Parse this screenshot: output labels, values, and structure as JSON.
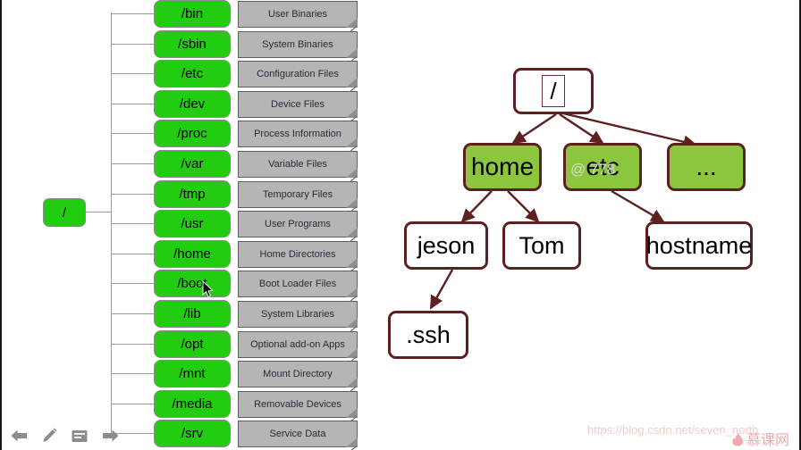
{
  "colors": {
    "dir_chip_green": "#22cc11",
    "note_gray": "#b5b5b5",
    "tree_node_green": "#8cc63e",
    "tree_border": "#5e1f1f",
    "connector_gray": "#9a9a9a",
    "watermark_pink": "#f0cccc",
    "toolbar_gray": "#8c8c8c"
  },
  "left_diagram": {
    "root_label": "/",
    "rows": [
      {
        "dir": "/bin",
        "desc": "User Binaries"
      },
      {
        "dir": "/sbin",
        "desc": "System Binaries"
      },
      {
        "dir": "/etc",
        "desc": "Configuration Files"
      },
      {
        "dir": "/dev",
        "desc": "Device Files"
      },
      {
        "dir": "/proc",
        "desc": "Process Information"
      },
      {
        "dir": "/var",
        "desc": "Variable Files"
      },
      {
        "dir": "/tmp",
        "desc": "Temporary Files"
      },
      {
        "dir": "/usr",
        "desc": "User Programs"
      },
      {
        "dir": "/home",
        "desc": "Home Directories"
      },
      {
        "dir": "/boot",
        "desc": "Boot Loader Files"
      },
      {
        "dir": "/lib",
        "desc": "System Libraries"
      },
      {
        "dir": "/opt",
        "desc": "Optional add-on Apps"
      },
      {
        "dir": "/mnt",
        "desc": "Mount Directory"
      },
      {
        "dir": "/media",
        "desc": "Removable Devices"
      },
      {
        "dir": "/srv",
        "desc": "Service Data"
      }
    ]
  },
  "right_tree": {
    "root": {
      "label": "/"
    },
    "level1": [
      {
        "label": "home"
      },
      {
        "label": "etc"
      },
      {
        "label": "..."
      }
    ],
    "level2": [
      {
        "label": "jeson"
      },
      {
        "label": "Tom"
      },
      {
        "label": "hostname"
      }
    ],
    "level3": [
      {
        "label": ".ssh"
      }
    ]
  },
  "watermarks": {
    "etc_overlay": "@    778",
    "url": "https://blog.csdn.net/seven_north",
    "logo_text": "慕课网",
    "logo_icon": "flame-icon"
  },
  "toolbar": {
    "items": [
      {
        "icon": "arrow-left-icon",
        "name": "previous-slide-button"
      },
      {
        "icon": "pencil-icon",
        "name": "annotate-button"
      },
      {
        "icon": "note-icon",
        "name": "notes-button"
      },
      {
        "icon": "arrow-right-icon",
        "name": "next-slide-button"
      }
    ]
  },
  "cursor": {
    "icon": "mouse-pointer-icon"
  }
}
